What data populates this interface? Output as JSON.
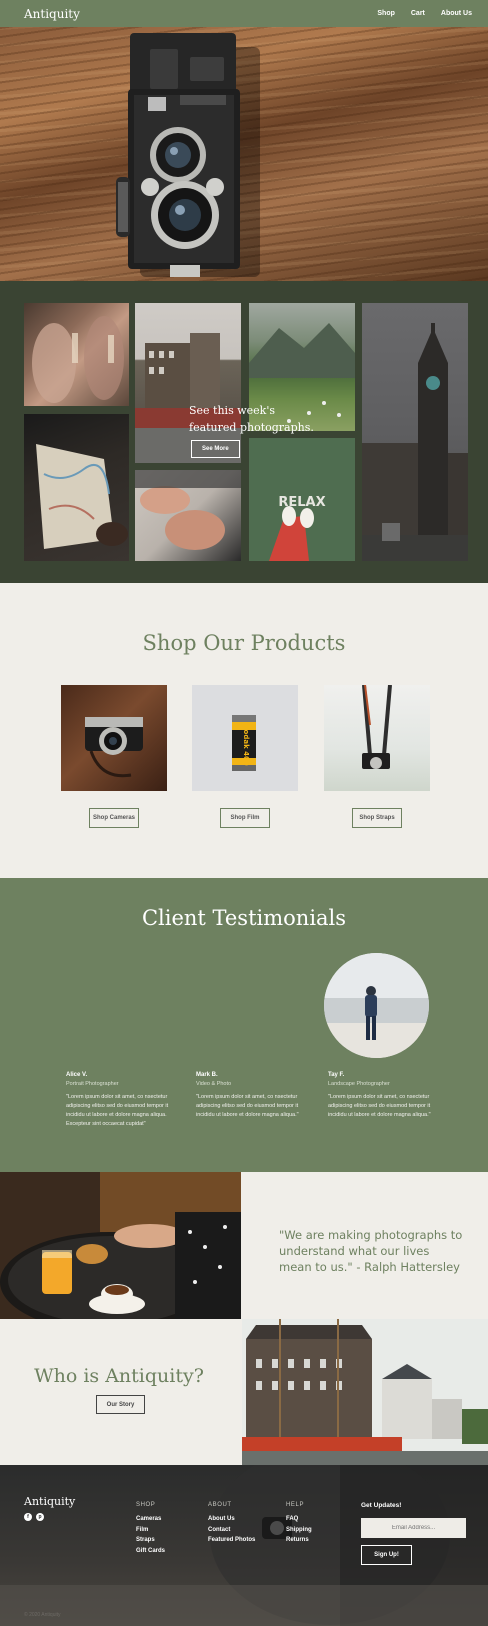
{
  "nav": {
    "logo": "Antiquity",
    "links": [
      "Shop",
      "Cart",
      "About Us"
    ]
  },
  "featured": {
    "text_line1": "See this week's",
    "text_line2": "featured photographs.",
    "button": "See More",
    "relax_text": "RELAX"
  },
  "shop": {
    "title": "Shop Our Products",
    "products": [
      {
        "button": "Shop Cameras"
      },
      {
        "button": "Shop Film",
        "film_label": "Kodak 400"
      },
      {
        "button": "Shop Straps"
      }
    ]
  },
  "testimonials": {
    "title": "Client Testimonials",
    "items": [
      {
        "name": "Alice V.",
        "role": "Portrait Photographer",
        "quote": "\"Lorem ipsum dolor sit amet, co nsectetur adipiscing elitso sed do eiusmod tempor it incididu ut labore et dolore magna aliqua. Excepteur sint occaecat cupidat\""
      },
      {
        "name": "Mark B.",
        "role": "Video & Photo",
        "quote": "\"Lorem ipsum dolor sit amet, co nsectetur adipiscing elitso sed do eiusmod tempor it incididu ut labore et dolore magna aliqua.\""
      },
      {
        "name": "Tay F.",
        "role": "Landscape Photographer",
        "quote": "\"Lorem ipsum dolor sit amet, co nsectetur adipiscing elitso sed do eiusmod tempor it incididu ut labore et dolore magna aliqua.\""
      }
    ]
  },
  "quote": {
    "text": "\"We are making photographs to understand what our lives mean to us.\"  - Ralph Hattersley"
  },
  "about": {
    "title": "Who is Antiquity?",
    "button": "Our Story"
  },
  "footer": {
    "logo": "Antiquity",
    "columns": [
      {
        "heading": "SHOP",
        "items": [
          "Cameras",
          "Film",
          "Straps",
          "Gift Cards"
        ]
      },
      {
        "heading": "ABOUT",
        "items": [
          "About Us",
          "Contact",
          "Featured Photos"
        ]
      },
      {
        "heading": "HELP",
        "items": [
          "FAQ",
          "Shipping",
          "Returns"
        ]
      }
    ],
    "updates_title": "Get Updates!",
    "email_placeholder": "Email Address...",
    "signup_button": "Sign Up!",
    "copyright": "© 2020 Antiquity"
  },
  "colors": {
    "brand_green": "#6e8160",
    "dark_green": "#3a4433",
    "cream": "#f0eee9"
  }
}
